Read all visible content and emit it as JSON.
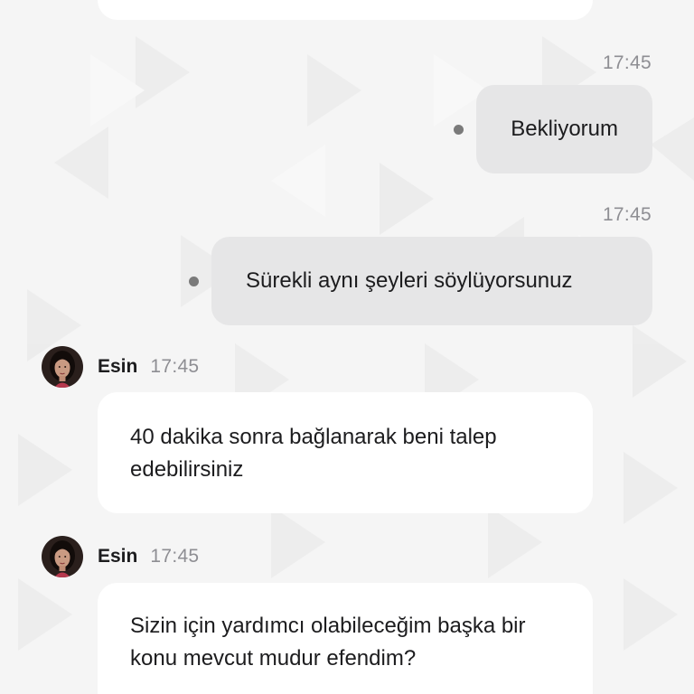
{
  "colors": {
    "background": "#f5f5f5",
    "outgoing_bubble": "#e6e6e7",
    "incoming_bubble": "#ffffff",
    "timestamp": "#8e8e93",
    "status_dot": "#7a7a7a"
  },
  "messages": {
    "outgoing": [
      {
        "time": "17:45",
        "text": "Bekliyorum",
        "status_icon": "sent-dot-icon"
      },
      {
        "time": "17:45",
        "text": "Sürekli aynı şeyleri söylüyorsunuz",
        "status_icon": "sent-dot-icon"
      }
    ],
    "incoming": [
      {
        "sender": "Esin",
        "time": "17:45",
        "avatar_icon": "agent-avatar",
        "text": "40 dakika sonra bağlanarak beni talep edebilirsiniz"
      },
      {
        "sender": "Esin",
        "time": "17:45",
        "avatar_icon": "agent-avatar",
        "text": "Sizin için yardımcı olabileceğim başka bir konu mevcut mudur efendim?"
      }
    ]
  }
}
